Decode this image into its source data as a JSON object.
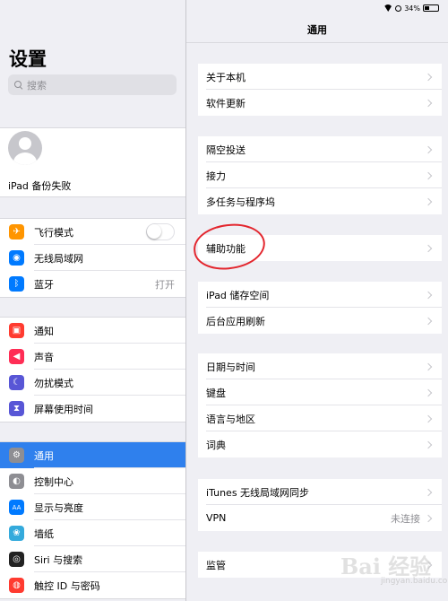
{
  "sidebar": {
    "title": "设置",
    "search_placeholder": "搜索",
    "profile": {
      "status": "iPad 备份失败"
    },
    "group1": [
      {
        "label": "飞行模式",
        "icon": "airplane-icon",
        "color": "#ff9500",
        "glyph": "✈"
      },
      {
        "label": "无线局域网",
        "icon": "wifi-icon",
        "color": "#007aff",
        "glyph": "◉"
      },
      {
        "label": "蓝牙",
        "icon": "bluetooth-icon",
        "color": "#007aff",
        "glyph": "ᛒ",
        "value": "打开"
      }
    ],
    "group2": [
      {
        "label": "通知",
        "icon": "notifications-icon",
        "color": "#ff3b30",
        "glyph": "▣"
      },
      {
        "label": "声音",
        "icon": "sound-icon",
        "color": "#ff2d55",
        "glyph": "◀"
      },
      {
        "label": "勿扰模式",
        "icon": "moon-icon",
        "color": "#5856d6",
        "glyph": "☾"
      },
      {
        "label": "屏幕使用时间",
        "icon": "hourglass-icon",
        "color": "#5856d6",
        "glyph": "⧗"
      }
    ],
    "group3": [
      {
        "label": "通用",
        "icon": "gear-icon",
        "color": "#8e8e93",
        "glyph": "⚙",
        "selected": true
      },
      {
        "label": "控制中心",
        "icon": "control-center-icon",
        "color": "#8e8e93",
        "glyph": "◐"
      },
      {
        "label": "显示与亮度",
        "icon": "display-icon",
        "color": "#007aff",
        "glyph": "AA"
      },
      {
        "label": "墙纸",
        "icon": "wallpaper-icon",
        "color": "#34aadc",
        "glyph": "❀"
      },
      {
        "label": "Siri 与搜索",
        "icon": "siri-icon",
        "color": "#222222",
        "glyph": "◎"
      },
      {
        "label": "触控 ID 与密码",
        "icon": "fingerprint-icon",
        "color": "#ff3b30",
        "glyph": "◍"
      }
    ]
  },
  "status_bar": {
    "battery": "34%"
  },
  "detail": {
    "title": "通用",
    "groups": [
      [
        {
          "label": "关于本机"
        },
        {
          "label": "软件更新"
        }
      ],
      [
        {
          "label": "隔空投送"
        },
        {
          "label": "接力"
        },
        {
          "label": "多任务与程序坞"
        }
      ],
      [
        {
          "label": "辅助功能"
        }
      ],
      [
        {
          "label": "iPad 储存空间"
        },
        {
          "label": "后台应用刷新"
        }
      ],
      [
        {
          "label": "日期与时间"
        },
        {
          "label": "键盘"
        },
        {
          "label": "语言与地区"
        },
        {
          "label": "词典"
        }
      ],
      [
        {
          "label": "iTunes 无线局域网同步"
        },
        {
          "label": "VPN",
          "value": "未连接"
        }
      ],
      [
        {
          "label": "监管"
        }
      ]
    ]
  },
  "watermark": {
    "text": "Bai 经验",
    "sub": "jingyan.baidu.com"
  },
  "colors": {
    "accent": "#2f80ed",
    "annotation": "#e3262e"
  }
}
